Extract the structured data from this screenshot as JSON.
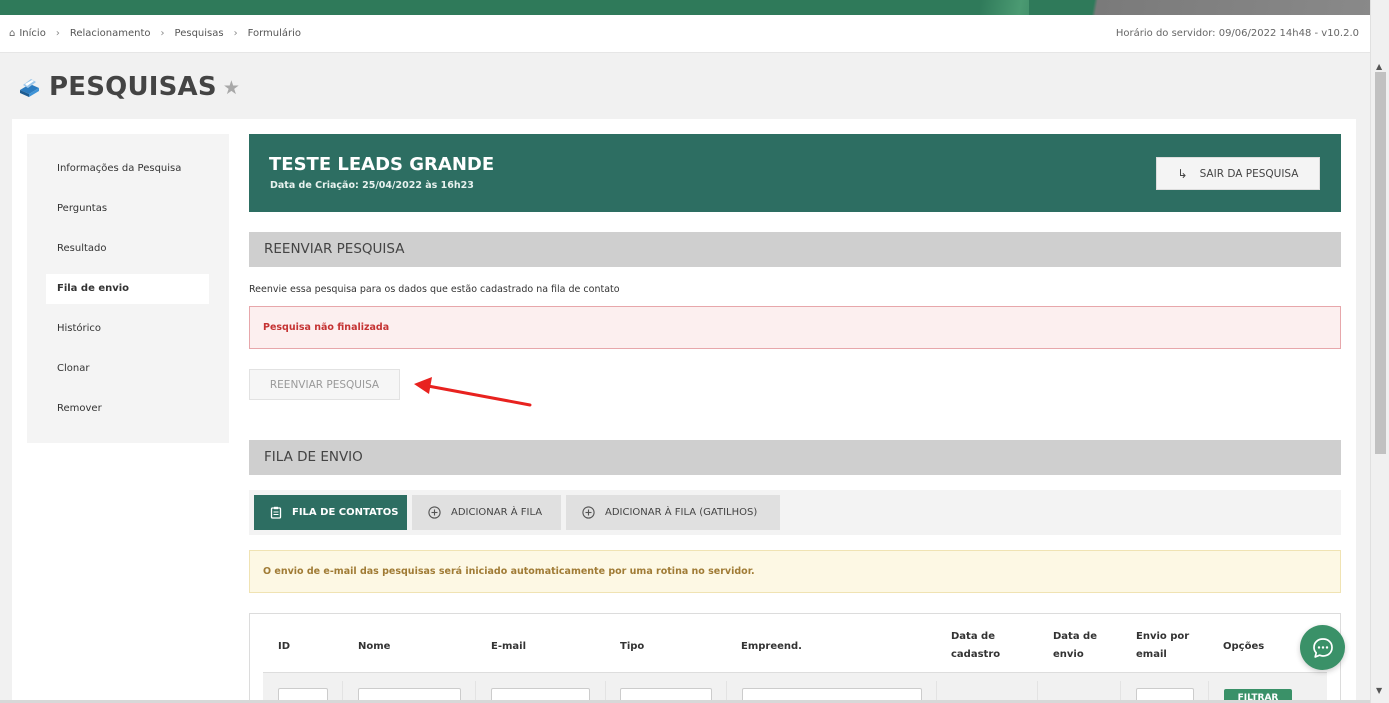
{
  "breadcrumb": {
    "items": [
      "Início",
      "Relacionamento",
      "Pesquisas",
      "Formulário"
    ],
    "server_time": "Horário do servidor: 09/06/2022 14h48 - v10.2.0"
  },
  "page": {
    "title": "PESQUISAS"
  },
  "sidebar": {
    "items": [
      {
        "label": "Informações da Pesquisa"
      },
      {
        "label": "Perguntas"
      },
      {
        "label": "Resultado"
      },
      {
        "label": "Fila de envio"
      },
      {
        "label": "Histórico"
      },
      {
        "label": "Clonar"
      },
      {
        "label": "Remover"
      }
    ],
    "active_index": 3
  },
  "survey": {
    "title": "TESTE LEADS GRANDE",
    "created": "Data de Criação: 25/04/2022 às 16h23",
    "exit_label": "SAIR DA PESQUISA"
  },
  "resend": {
    "header": "REENVIAR PESQUISA",
    "description": "Reenvie essa pesquisa para os dados que estão cadastrado na fila de contato",
    "error": "Pesquisa não finalizada",
    "button_label": "REENVIAR PESQUISA"
  },
  "queue": {
    "header": "FILA DE ENVIO",
    "tabs": [
      {
        "label": "FILA DE CONTATOS",
        "icon": "clipboard-icon"
      },
      {
        "label": "ADICIONAR À FILA",
        "icon": "plus-circle-icon"
      },
      {
        "label": "ADICIONAR À FILA (GATILHOS)",
        "icon": "plus-circle-icon"
      }
    ],
    "warning": "O envio de e-mail das pesquisas será iniciado automaticamente por uma rotina no servidor."
  },
  "table": {
    "columns": [
      {
        "line1": "ID",
        "line2": ""
      },
      {
        "line1": "Nome",
        "line2": ""
      },
      {
        "line1": "E-mail",
        "line2": ""
      },
      {
        "line1": "Tipo",
        "line2": ""
      },
      {
        "line1": "Empreend.",
        "line2": ""
      },
      {
        "line1": "Data de",
        "line2": "cadastro"
      },
      {
        "line1": "Data de",
        "line2": "envio"
      },
      {
        "line1": "Envio por",
        "line2": "email"
      },
      {
        "line1": "Opções",
        "line2": ""
      }
    ],
    "filter_button": "FILTRAR"
  },
  "colors": {
    "primary": "#2d6e62",
    "accent": "#3a9168",
    "error": "#c53333",
    "warning_text": "#a07b35"
  }
}
